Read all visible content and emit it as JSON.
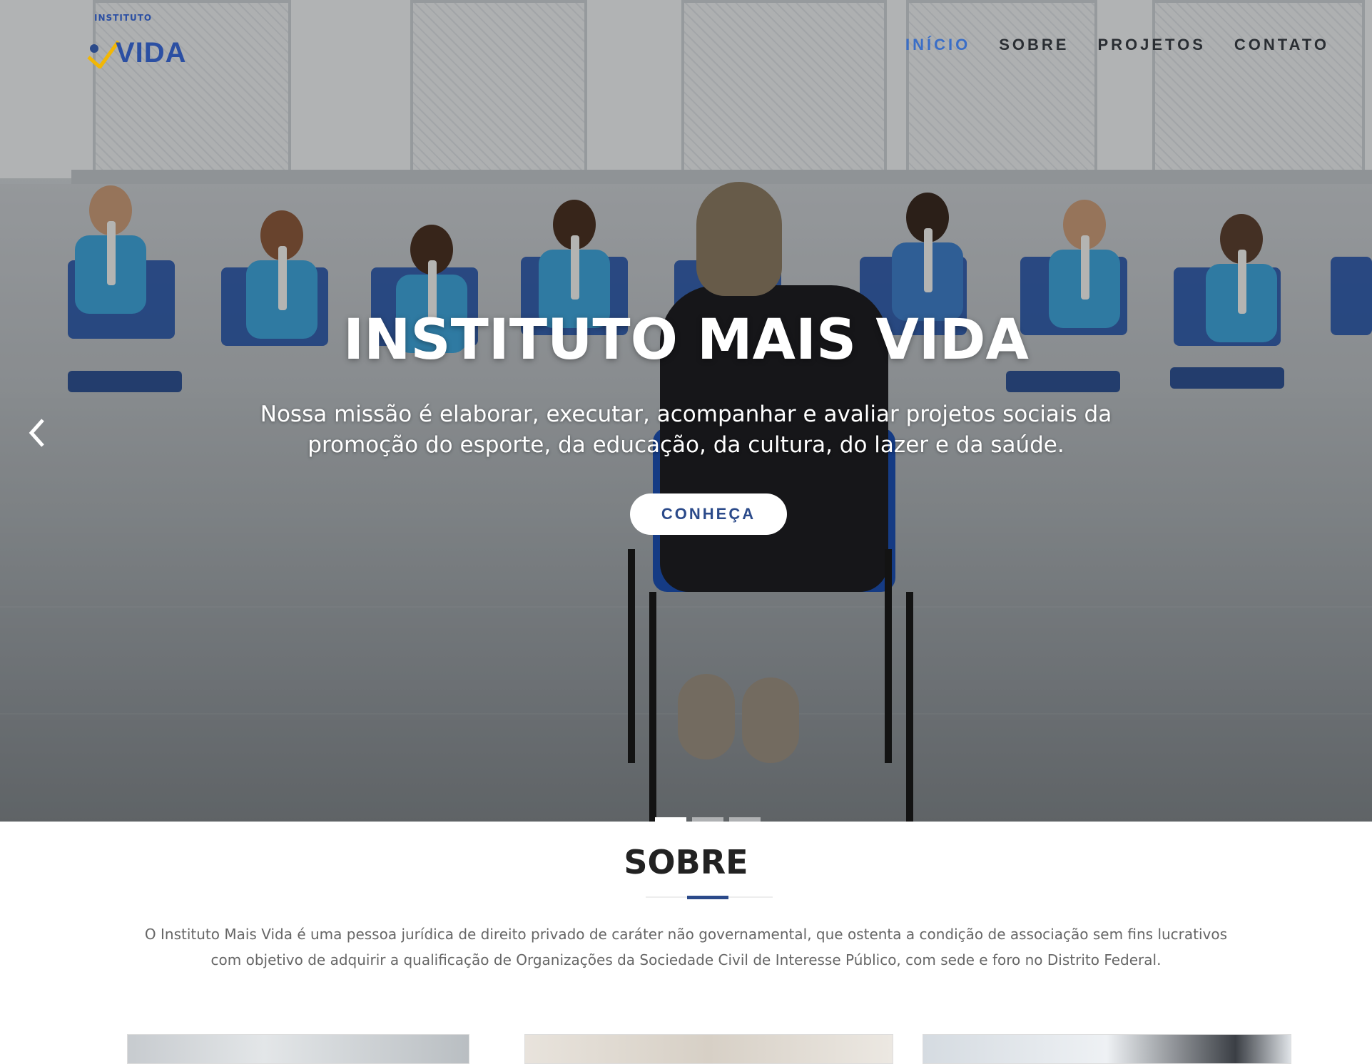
{
  "brand": {
    "logo_small": "INSTITUTO",
    "logo_big": "VIDA",
    "primary_color": "#2b4a8a",
    "accent_color": "#f2b705"
  },
  "nav": {
    "items": [
      {
        "label": "INÍCIO",
        "active": true
      },
      {
        "label": "SOBRE",
        "active": false
      },
      {
        "label": "PROJETOS",
        "active": false
      },
      {
        "label": "CONTATO",
        "active": false
      }
    ]
  },
  "hero": {
    "title": "INSTITUTO MAIS VIDA",
    "text": "Nossa missão é elaborar, executar, acompanhar e avaliar projetos sociais da promoção do esporte, da educação, da cultura, do lazer e da saúde.",
    "button": "CONHEÇA",
    "prev_icon": "chevron-left-icon",
    "slides": 3,
    "active_slide": 1
  },
  "sobre": {
    "title": "SOBRE",
    "text": "O Instituto Mais Vida é uma pessoa jurídica de direito privado de caráter não governamental, que ostenta a condição de associação sem fins lucrativos com objetivo de adquirir a qualificação de Organizações da Sociedade Civil de Interesse Público, com sede e foro no Distrito Federal."
  }
}
